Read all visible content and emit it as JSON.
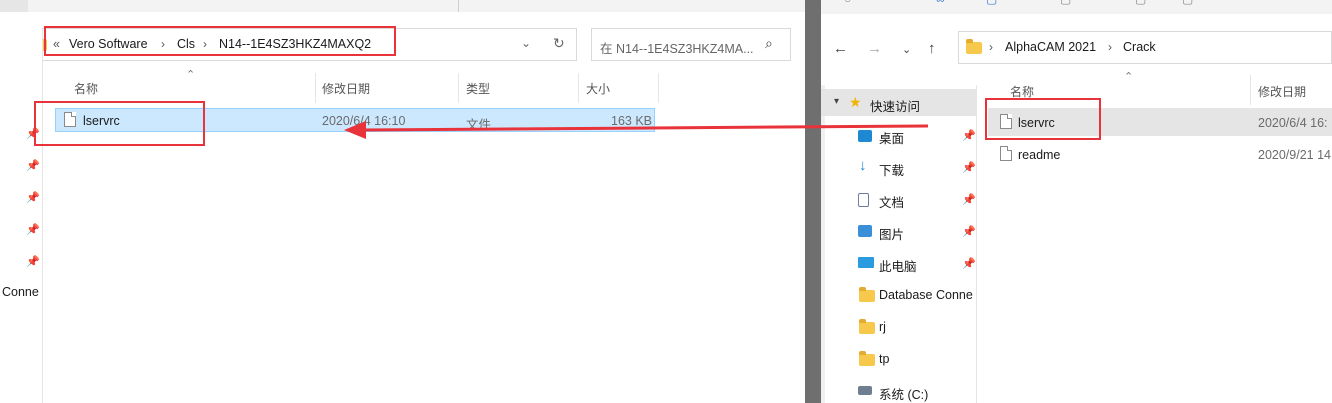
{
  "left_window": {
    "breadcrumb": {
      "overflow": "«",
      "items": [
        "Vero Software",
        "Cls",
        "N14--1E4SZ3HKZ4MAXQ2"
      ]
    },
    "search_placeholder": "在 N14--1E4SZ3HKZ4MA...",
    "columns": [
      "名称",
      "修改日期",
      "类型",
      "大小"
    ],
    "files": [
      {
        "name": "lservrc",
        "modified": "2020/6/4 16:10",
        "type": "文件",
        "size": "163 KB",
        "selected": true
      }
    ],
    "sidebar_partial_label": "Conne"
  },
  "right_window": {
    "breadcrumb": {
      "items": [
        "AlphaCAM 2021",
        "Crack"
      ]
    },
    "columns": [
      "名称",
      "修改日期"
    ],
    "files": [
      {
        "name": "lservrc",
        "modified": "2020/6/4 16:",
        "selected": true
      },
      {
        "name": "readme",
        "modified": "2020/9/21 14"
      }
    ],
    "nav": {
      "quick_access": "快速访问",
      "items": [
        {
          "label": "桌面",
          "icon": "desktop-icon",
          "pinned": true
        },
        {
          "label": "下载",
          "icon": "download-icon",
          "pinned": true
        },
        {
          "label": "文档",
          "icon": "document-icon",
          "pinned": true
        },
        {
          "label": "图片",
          "icon": "picture-icon",
          "pinned": true
        },
        {
          "label": "此电脑",
          "icon": "computer-icon",
          "pinned": true
        },
        {
          "label": "Database Conne",
          "icon": "folder-icon",
          "pinned": false
        },
        {
          "label": "rj",
          "icon": "folder-icon",
          "pinned": false
        },
        {
          "label": "tp",
          "icon": "folder-icon",
          "pinned": false
        },
        {
          "label": "系统 (C:)",
          "icon": "drive-icon",
          "pinned": false
        }
      ]
    }
  },
  "annotation_color": "#e8333a",
  "selection_color": "#cce8ff"
}
